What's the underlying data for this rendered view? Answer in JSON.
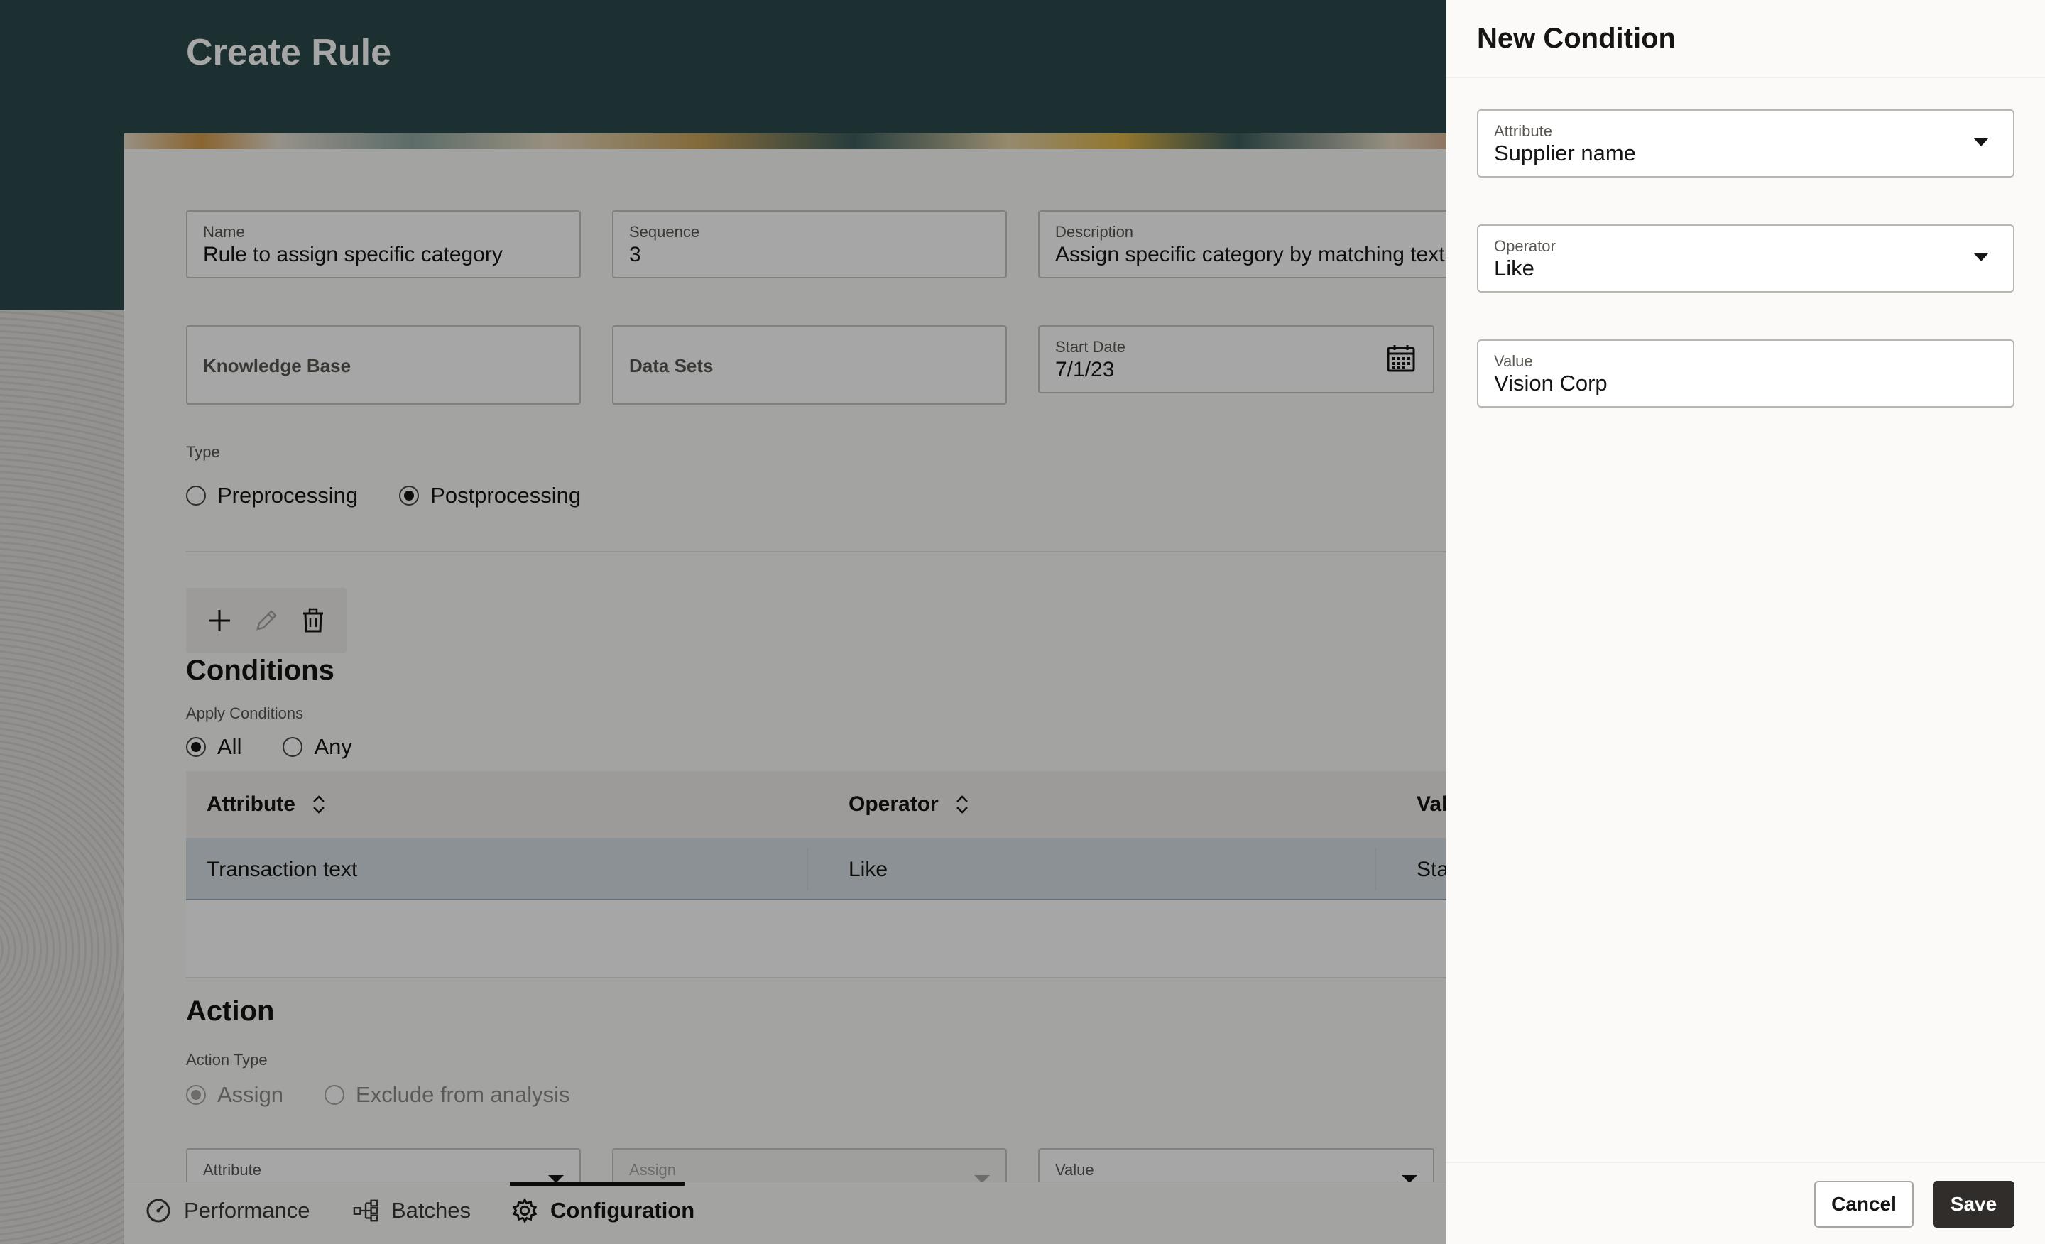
{
  "page": {
    "title": "Create Rule"
  },
  "form": {
    "name": {
      "label": "Name",
      "value": "Rule to assign specific category"
    },
    "sequence": {
      "label": "Sequence",
      "value": "3"
    },
    "description": {
      "label": "Description",
      "value": "Assign specific category by matching text f"
    },
    "knowledge_base": {
      "placeholder": "Knowledge Base"
    },
    "data_sets": {
      "placeholder": "Data Sets"
    },
    "start_date": {
      "label": "Start Date",
      "value": "7/1/23",
      "icon": "calendar-icon"
    },
    "type": {
      "label": "Type",
      "options": [
        "Preprocessing",
        "Postprocessing"
      ],
      "selected": "Postprocessing"
    }
  },
  "conditions": {
    "toolbar": {
      "add_icon": "plus-icon",
      "edit_icon": "pencil-icon",
      "delete_icon": "trash-icon"
    },
    "heading": "Conditions",
    "apply_label": "Apply Conditions",
    "apply_options": [
      "All",
      "Any"
    ],
    "apply_selected": "All",
    "columns": [
      "Attribute",
      "Operator",
      "Val"
    ],
    "rows": [
      {
        "attribute": "Transaction text",
        "operator": "Like",
        "value": "Sta"
      }
    ]
  },
  "action": {
    "heading": "Action",
    "type_label": "Action Type",
    "type_options": [
      "Assign",
      "Exclude from analysis"
    ],
    "type_selected": "Assign",
    "fields": {
      "attribute_label": "Attribute",
      "assign_label": "Assign",
      "value_label": "Value"
    }
  },
  "bottom_nav": {
    "items": [
      {
        "label": "Performance",
        "icon": "gauge-icon"
      },
      {
        "label": "Batches",
        "icon": "hierarchy-icon"
      },
      {
        "label": "Configuration",
        "icon": "gear-icon"
      }
    ],
    "active": "Configuration"
  },
  "drawer": {
    "title": "New Condition",
    "attribute": {
      "label": "Attribute",
      "value": "Supplier name"
    },
    "operator": {
      "label": "Operator",
      "value": "Like"
    },
    "value": {
      "label": "Value",
      "value": "Vision Corp"
    },
    "cancel_label": "Cancel",
    "save_label": "Save"
  },
  "colors": {
    "hero": "#2b4a4e",
    "selected_row": "#d6dfe3",
    "primary_button": "#312d2a"
  }
}
